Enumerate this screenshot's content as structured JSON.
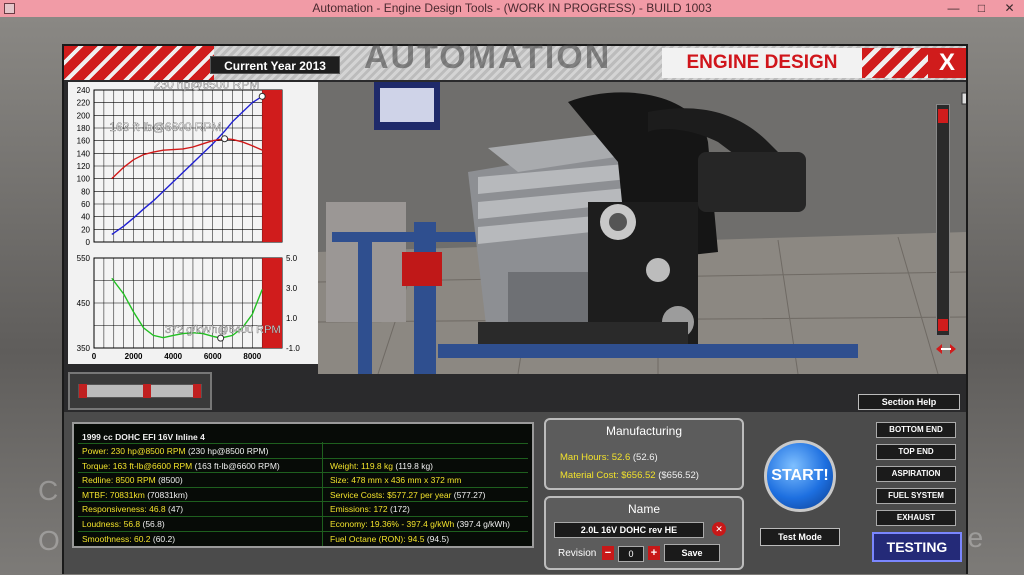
{
  "window_title": "Automation - Engine Design Tools - (WORK IN PROGRESS) - BUILD 1003",
  "title_controls": {
    "minimize": "—",
    "maximize": "□",
    "close": "✕"
  },
  "header": {
    "current_year": "Current Year 2013",
    "section_title": "ENGINE DESIGN",
    "close_label": "X",
    "logo_text": "AUTOMATION"
  },
  "background_text": {
    "left1": "C",
    "left2": "O",
    "right": "ne"
  },
  "chart_data": [
    {
      "type": "line",
      "title": "",
      "xlabel": "",
      "ylabel": "",
      "x": [
        900,
        1500,
        2000,
        2500,
        3000,
        3500,
        4000,
        4500,
        5000,
        5500,
        6000,
        6600,
        7000,
        7500,
        8000,
        8500
      ],
      "ylim": [
        0,
        240
      ],
      "y_ticks": [
        "240",
        "220",
        "200",
        "180",
        "160",
        "140",
        "120",
        "100",
        "80",
        "60",
        "40",
        "20",
        "0"
      ],
      "redline_start": 8500,
      "series": [
        {
          "name": "Power",
          "color": "#2020d0",
          "values": [
            12,
            25,
            38,
            52,
            65,
            80,
            95,
            110,
            125,
            140,
            155,
            175,
            190,
            205,
            220,
            230
          ]
        },
        {
          "name": "Torque",
          "color": "#d01818",
          "values": [
            100,
            118,
            130,
            138,
            142,
            145,
            146,
            147,
            150,
            155,
            160,
            163,
            162,
            158,
            152,
            145
          ]
        }
      ],
      "annotations": [
        {
          "text": "230 hp@8500 RPM",
          "x": 8500,
          "y": 230
        },
        {
          "text": "163 ft-lb@6600 RPM",
          "x": 6600,
          "y": 163
        }
      ]
    },
    {
      "type": "line",
      "title": "",
      "xlabel": "",
      "ylabel": "",
      "x": [
        900,
        1500,
        2000,
        2500,
        3000,
        3500,
        4000,
        4500,
        5000,
        5500,
        6000,
        6400,
        7000,
        7500,
        8000,
        8500
      ],
      "ylim": [
        350,
        550
      ],
      "y_ticks": [
        "550",
        "450",
        "350"
      ],
      "y2_ticks": [
        "5.0",
        "3.0",
        "1.0",
        "-1.0"
      ],
      "x_ticks": [
        "0",
        "2000",
        "4000",
        "6000",
        "8000"
      ],
      "x_tick_values": [
        0,
        2000,
        4000,
        6000,
        8000
      ],
      "xlim": [
        0,
        9500
      ],
      "series": [
        {
          "name": "BSFC",
          "color": "#22c022",
          "values": [
            505,
            470,
            430,
            395,
            378,
            373,
            378,
            382,
            384,
            382,
            376,
            372,
            378,
            395,
            425,
            480
          ]
        }
      ],
      "annotations": [
        {
          "text": "372 g/kWh@6400 RPM",
          "x": 6400,
          "y": 372
        }
      ]
    }
  ],
  "slider": {
    "value_fraction": 0.55
  },
  "section_help": "Section Help",
  "stats": {
    "title": "1999 cc DOHC EFI 16V Inline 4",
    "left": [
      {
        "label": "Power: 230 hp@8500 RPM",
        "extra": "(230 hp@8500 RPM)"
      },
      {
        "label": "Torque: 163 ft-lb@6600 RPM",
        "extra": "(163 ft-lb@6600 RPM)"
      },
      {
        "label": "Redline: 8500 RPM",
        "extra": "(8500)"
      },
      {
        "label": "MTBF: 70831km",
        "extra": "(70831km)"
      },
      {
        "label": "Responsiveness: 46.8",
        "extra": "(47)"
      },
      {
        "label": "Loudness: 56.8",
        "extra": "(56.8)"
      },
      {
        "label": "Smoothness: 60.2",
        "extra": "(60.2)"
      }
    ],
    "right": [
      {
        "label": "",
        "extra": ""
      },
      {
        "label": "Weight: 119.8 kg",
        "extra": "(119.8 kg)"
      },
      {
        "label": "Size: 478 mm x 436 mm x 372 mm",
        "extra": ""
      },
      {
        "label": "Service Costs: $577.27 per year",
        "extra": "(577.27)"
      },
      {
        "label": "Emissions: 172",
        "extra": "(172)"
      },
      {
        "label": "Economy: 19.36% - 397.4 g/kWh",
        "extra": "(397.4 g/kWh)"
      },
      {
        "label": "Fuel Octane (RON): 94.5",
        "extra": "(94.5)"
      }
    ]
  },
  "manufacturing": {
    "title": "Manufacturing",
    "man_hours_label": "Man Hours: 52.6",
    "man_hours_extra": "(52.6)",
    "material_cost_label": "Material Cost: $656.52",
    "material_cost_extra": "($656.52)"
  },
  "name_panel": {
    "title": "Name",
    "name_value": "2.0L 16V DOHC rev HE",
    "revision_label": "Revision",
    "revision_value": "0",
    "save_label": "Save"
  },
  "start_label": "START!",
  "test_mode_label": "Test Mode",
  "side_buttons": [
    "BOTTOM END",
    "TOP END",
    "ASPIRATION",
    "FUEL SYSTEM",
    "EXHAUST"
  ],
  "testing_label": "TESTING",
  "colors": {
    "accent_red": "#d01c1c",
    "stat_yellow": "#f2e22c",
    "start_blue": "#1d6fe0"
  }
}
